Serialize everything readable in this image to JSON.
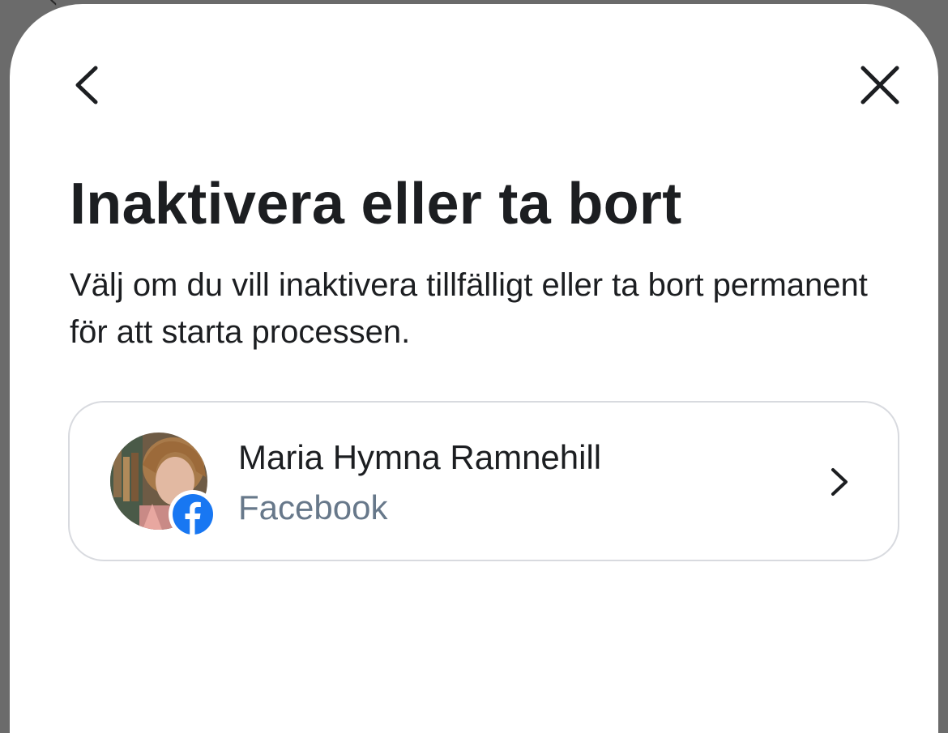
{
  "header": {
    "back_icon": "chevron-left-icon",
    "close_icon": "close-icon"
  },
  "main": {
    "title": "Inaktivera eller ta bort",
    "subtitle": "Välj om du vill inaktivera tillfälligt eller ta bort permanent för att starta processen."
  },
  "account": {
    "name": "Maria Hymna Ramnehill",
    "platform": "Facebook",
    "badge_icon": "facebook-icon",
    "chevron_icon": "chevron-right-icon"
  },
  "colors": {
    "text_primary": "#1c1e21",
    "text_secondary": "#67788a",
    "card_border": "#d8dadf",
    "facebook_blue": "#1877f2",
    "backdrop": "#6b6b6b"
  }
}
